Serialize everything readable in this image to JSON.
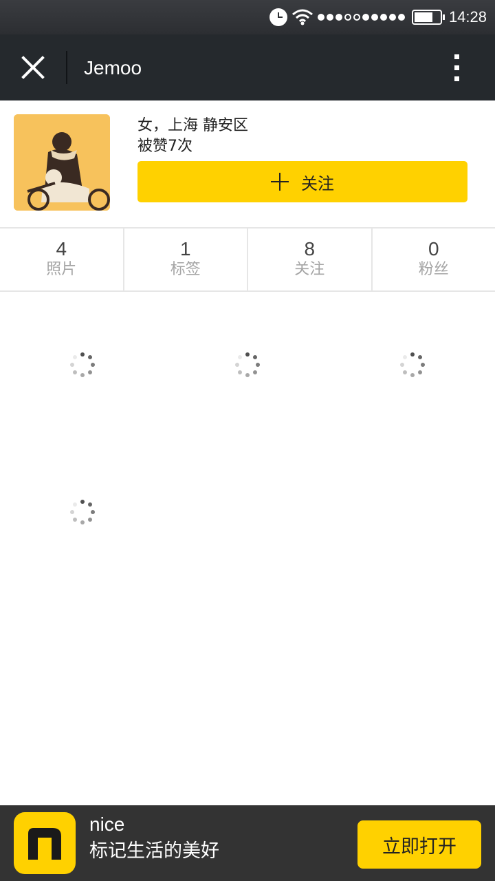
{
  "status_bar": {
    "time": "14:28",
    "icons": [
      "alarm-clock-icon",
      "wifi-icon",
      "signal-dots-icon",
      "battery-icon"
    ]
  },
  "title_bar": {
    "title": "Jemoo",
    "close_icon": "close-icon",
    "more_icon": "more-vertical-icon"
  },
  "profile": {
    "info_line1": "女，上海 静安区",
    "info_line2": "被赞7次",
    "follow_label": "关注",
    "follow_icon": "plus-icon"
  },
  "stats": [
    {
      "value": "4",
      "label": "照片"
    },
    {
      "value": "1",
      "label": "标签"
    },
    {
      "value": "8",
      "label": "关注"
    },
    {
      "value": "0",
      "label": "粉丝"
    }
  ],
  "grid": {
    "loading_items": 4,
    "icon": "loading-spinner-icon"
  },
  "banner": {
    "app_name": "nice",
    "slogan": "标记生活的美好",
    "open_label": "立即打开",
    "brand_color": "#ffd100"
  }
}
